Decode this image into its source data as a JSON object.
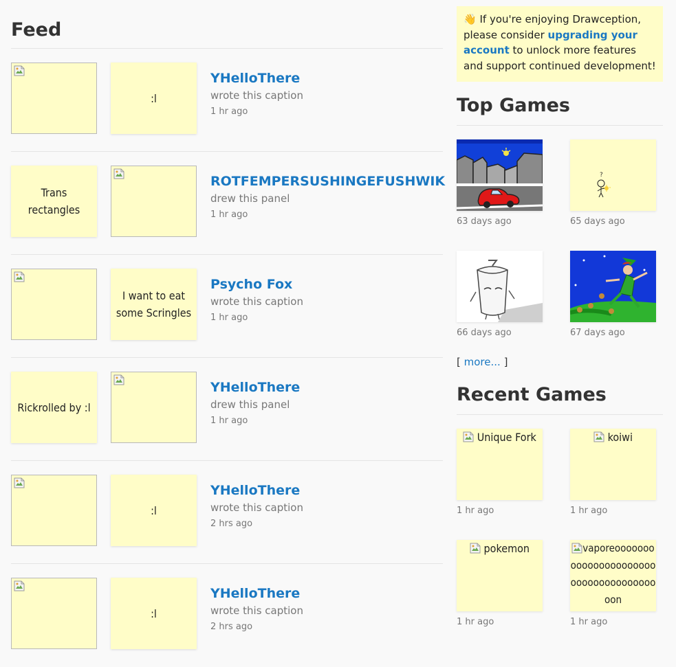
{
  "feed": {
    "title": "Feed",
    "items": [
      {
        "left_text": "",
        "right_text": ":l",
        "user": "YHelloThere",
        "action": "wrote this caption",
        "time": "1 hr ago"
      },
      {
        "left_text": "Trans rectangles",
        "right_text": "",
        "user": "ROTFEMPERSUSHINGEFUSHWIK",
        "action": "drew this panel",
        "time": "1 hr ago"
      },
      {
        "left_text": "",
        "right_text": "I want to eat some Scringles",
        "user": "Psycho Fox",
        "action": "wrote this caption",
        "time": "1 hr ago"
      },
      {
        "left_text": "Rickrolled by :l",
        "right_text": "",
        "user": "YHelloThere",
        "action": "drew this panel",
        "time": "1 hr ago"
      },
      {
        "left_text": "",
        "right_text": ":l",
        "user": "YHelloThere",
        "action": "wrote this caption",
        "time": "2 hrs ago"
      },
      {
        "left_text": "",
        "right_text": ":l",
        "user": "YHelloThere",
        "action": "wrote this caption",
        "time": "2 hrs ago"
      }
    ]
  },
  "notice": {
    "emoji": "👋",
    "before": "If you're enjoying Drawception, please consider ",
    "link": "upgrading your account",
    "after": " to unlock more features and support continued development!"
  },
  "top_games": {
    "title": "Top Games",
    "items": [
      {
        "ago": "63 days ago",
        "art": "city-car"
      },
      {
        "ago": "65 days ago",
        "art": "stick-figure"
      },
      {
        "ago": "66 days ago",
        "art": "cup-character"
      },
      {
        "ago": "67 days ago",
        "art": "elf-jumping"
      }
    ],
    "more_open": "[ ",
    "more_link": "more...",
    "more_close": " ]"
  },
  "recent_games": {
    "title": "Recent Games",
    "items": [
      {
        "caption": "Unique Fork",
        "ago": "1 hr ago"
      },
      {
        "caption": "koiwi",
        "ago": "1 hr ago"
      },
      {
        "caption": "pokemon",
        "ago": "1 hr ago"
      },
      {
        "caption": "vaporeooooooooooooooooooooooooooooooooooooooon",
        "ago": "1 hr ago"
      }
    ]
  },
  "colors": {
    "accent": "#1a78c2",
    "card": "#fffdc8",
    "background": "#f9f9f9"
  }
}
